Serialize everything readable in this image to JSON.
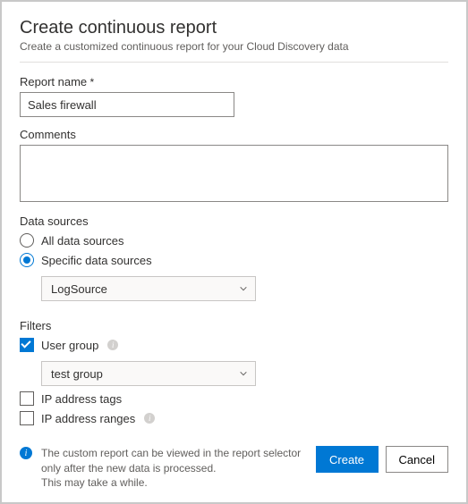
{
  "header": {
    "title": "Create continuous report",
    "subtitle": "Create a customized continuous report for your Cloud Discovery data"
  },
  "fields": {
    "report_name_label": "Report name",
    "report_name_value": "Sales firewall",
    "comments_label": "Comments",
    "comments_value": ""
  },
  "data_sources": {
    "section_label": "Data sources",
    "options": {
      "all": "All data sources",
      "specific": "Specific data sources"
    },
    "selected": "specific",
    "dropdown_value": "LogSource"
  },
  "filters": {
    "section_label": "Filters",
    "items": {
      "user_group": {
        "label": "User group",
        "checked": true,
        "dropdown_value": "test group"
      },
      "ip_tags": {
        "label": "IP address tags",
        "checked": false
      },
      "ip_ranges": {
        "label": "IP address ranges",
        "checked": false
      }
    }
  },
  "footer": {
    "info_text": "The custom report can be viewed in the report selector only after the new data is processed.\nThis may take a while.",
    "create_label": "Create",
    "cancel_label": "Cancel"
  }
}
